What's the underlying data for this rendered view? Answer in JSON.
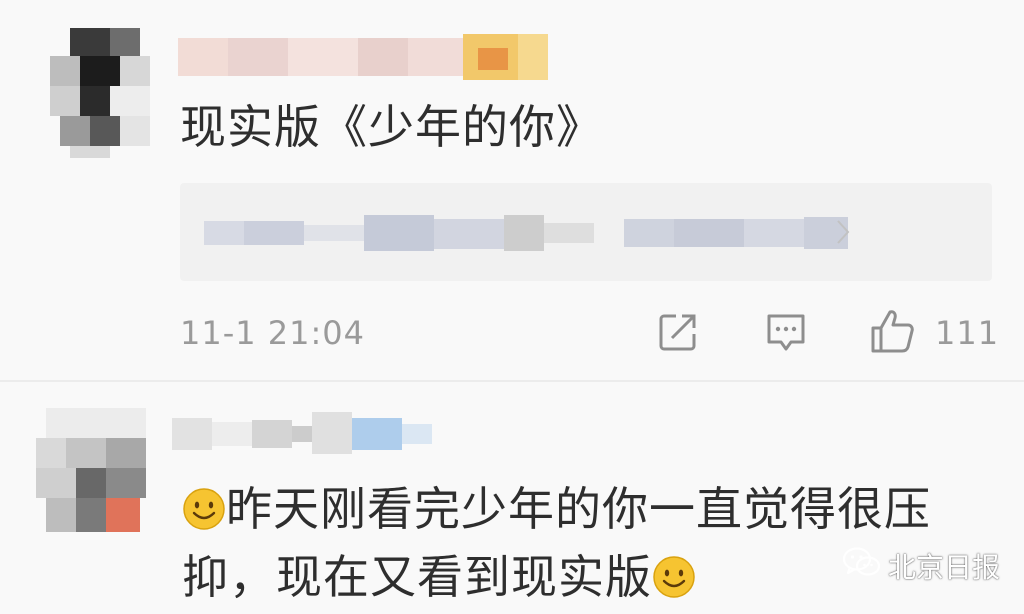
{
  "comments": [
    {
      "text": "现实版《少年的你》",
      "timestamp": "11-1 21:04",
      "like_count": "111",
      "icons": {
        "share": "share-icon",
        "reply": "comment-icon",
        "like": "thumbs-up-icon"
      }
    },
    {
      "text_line1": "昨天刚看完少年的你一直觉得很压",
      "text_line2": "抑，现在又看到现实版",
      "emoji": "smile-emoji"
    }
  ],
  "watermark": {
    "text": "北京日报",
    "icon": "wechat-icon"
  },
  "colors": {
    "background": "#f9f9f9",
    "text": "#2e2e2e",
    "meta_text": "#9a9a9a",
    "reply_box": "#f1f1f1",
    "emoji_face": "#f6c431"
  }
}
